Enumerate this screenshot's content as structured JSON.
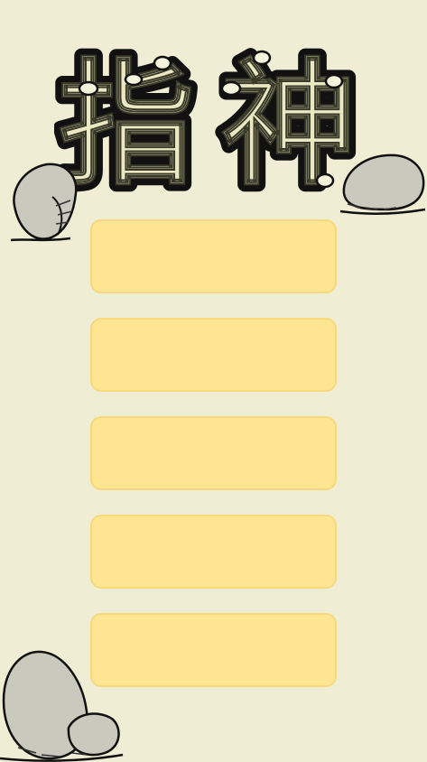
{
  "title": {
    "text": "指神",
    "char_1": "指",
    "char_2": "神"
  },
  "menu": {
    "buttons": [
      {
        "label": ""
      },
      {
        "label": ""
      },
      {
        "label": ""
      },
      {
        "label": ""
      },
      {
        "label": ""
      }
    ]
  },
  "colors": {
    "background": "#efeed5",
    "button_fill": "#fee592",
    "button_border": "#f7d87c",
    "title_fill": "#e9e8c2",
    "title_outline": "#111111",
    "rock_fill": "#c9c9bd"
  }
}
